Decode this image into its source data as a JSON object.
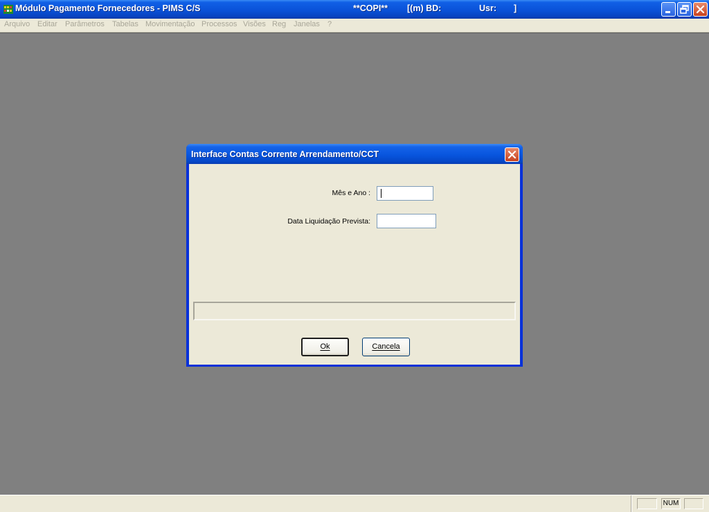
{
  "app": {
    "title": "Módulo Pagamento Fornecedores - PIMS C/S",
    "company": "**COPI**",
    "db_label": "[(m) BD:",
    "user_label": "Usr:",
    "user_close": "]"
  },
  "menu": {
    "items": [
      "Arquivo",
      "Editar",
      "Parâmetros",
      "Tabelas",
      "Movimentação",
      "Processos",
      "Visões",
      "Reg",
      "Janelas",
      "?"
    ]
  },
  "dialog": {
    "title": "Interface Contas Corrente Arrendamento/CCT",
    "month_year_label": "Mês e Ano :",
    "month_year_value": "",
    "settlement_date_label": "Data Liquidação Prevista:",
    "settlement_date_value": "",
    "ok_label": "Ok",
    "cancel_label": "Cancela",
    "progress": 0
  },
  "statusbar": {
    "num": "NUM"
  },
  "colors": {
    "desktop": "#808080",
    "titlebar_blue": "#0a52d8",
    "dialog_face": "#ece9d8",
    "close_red": "#c8421f"
  },
  "icons": [
    "app-icon",
    "minimize-icon",
    "restore-icon",
    "close-icon"
  ]
}
